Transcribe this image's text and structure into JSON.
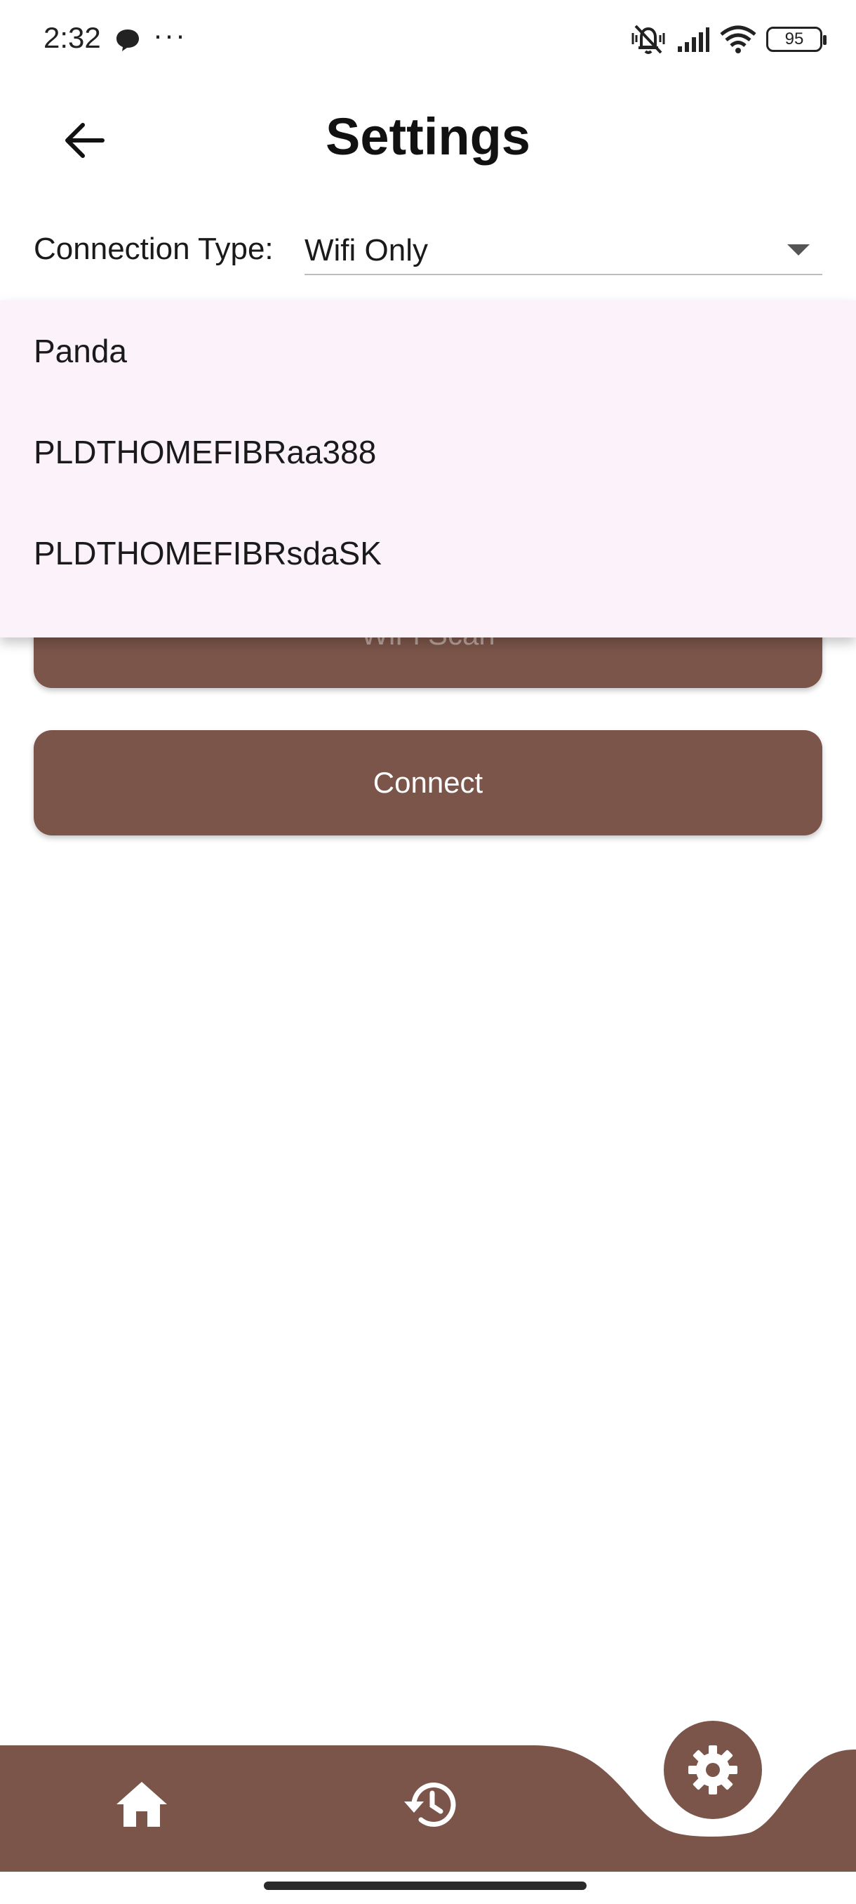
{
  "status_bar": {
    "time": "2:32",
    "more": "···",
    "battery": "95"
  },
  "header": {
    "title": "Settings"
  },
  "connection": {
    "label": "Connection Type:",
    "value": "Wifi Only"
  },
  "dropdown": {
    "items": [
      {
        "label": "Panda"
      },
      {
        "label": "PLDTHOMEFIBRaa388"
      },
      {
        "label": "PLDTHOMEFIBRsdaSK"
      }
    ]
  },
  "buttons": {
    "scan": "WiFi Scan",
    "connect": "Connect"
  },
  "bottom_nav": {
    "items": [
      "home-icon",
      "history-icon",
      "gear-icon"
    ],
    "active": "gear-icon"
  },
  "colors": {
    "brand": "#7b5549",
    "menu_background": "#fcf3fa"
  }
}
